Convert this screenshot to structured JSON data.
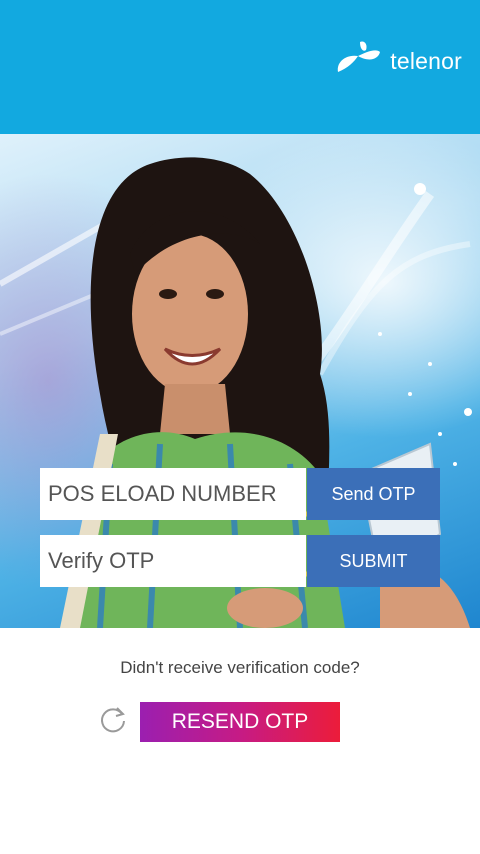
{
  "header": {
    "brand_name": "telenor",
    "background_color": "#12a9e0",
    "logo_icon": "telenor-propeller-icon"
  },
  "hero": {
    "image": "smiling-woman-promo-photo"
  },
  "form": {
    "phone_placeholder": "POS ELOAD NUMBER",
    "send_otp_label": "Send OTP",
    "otp_placeholder": "Verify OTP",
    "submit_label": "SUBMIT",
    "button_color": "#3b6fb8"
  },
  "footer": {
    "prompt_text": "Didn't receive verification code?",
    "refresh_icon": "refresh-icon",
    "resend_label": "RESEND OTP"
  }
}
